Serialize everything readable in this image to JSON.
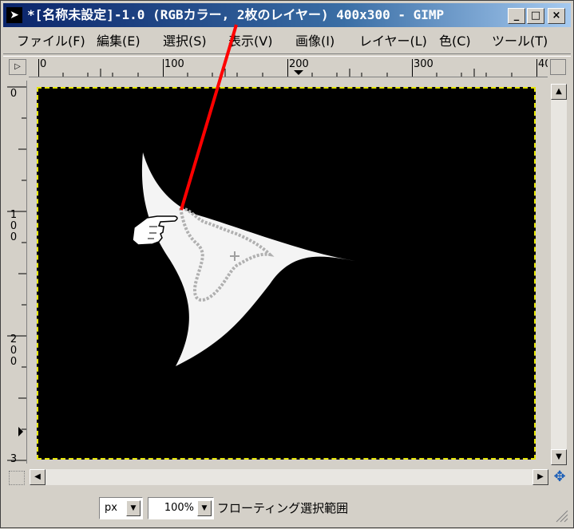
{
  "window": {
    "title": "*[名称未設定]-1.0 (RGBカラー, 2枚のレイヤー) 400x300 - GIMP",
    "minimize_glyph": "_",
    "maximize_glyph": "□",
    "close_glyph": "×",
    "app_icon_glyph": "➤"
  },
  "menu": {
    "file": "ファイル(F)",
    "edit": "編集(E)",
    "select": "選択(S)",
    "view": "表示(V)",
    "image": "画像(I)",
    "layer": "レイヤー(L)",
    "color": "色(C)",
    "tools": "ツール(T)"
  },
  "ruler": {
    "h_labels": [
      "0",
      "100",
      "200",
      "300",
      "40"
    ],
    "v_labels": [
      "0",
      "1\n0\n0",
      "2\n0\n0",
      "3"
    ]
  },
  "statusbar": {
    "unit": "px",
    "zoom": "100%",
    "message": "フローティング選択範囲"
  },
  "colors": {
    "titlebar_start": "#0a246a",
    "titlebar_end": "#a6caf0",
    "selection_border": "#e5e500",
    "annotation_line": "#ff0000"
  },
  "icons": {
    "nav": "navigate-icon",
    "pointer": "hand-pointer-icon",
    "resize": "resize-grip-icon"
  }
}
